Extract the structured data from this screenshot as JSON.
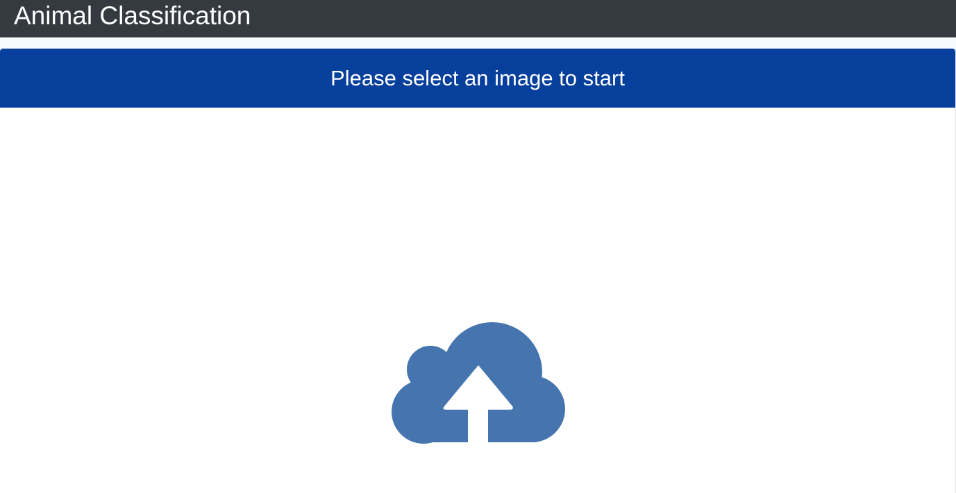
{
  "navbar": {
    "title": "Animal Classification"
  },
  "card": {
    "header_text": "Please select an image to start"
  },
  "upload": {
    "icon": "cloud-upload-icon",
    "icon_color": "#4574ae"
  },
  "colors": {
    "navbar_bg": "#343a40",
    "header_bg": "#063f9c",
    "page_bg": "#f8f9fa"
  }
}
